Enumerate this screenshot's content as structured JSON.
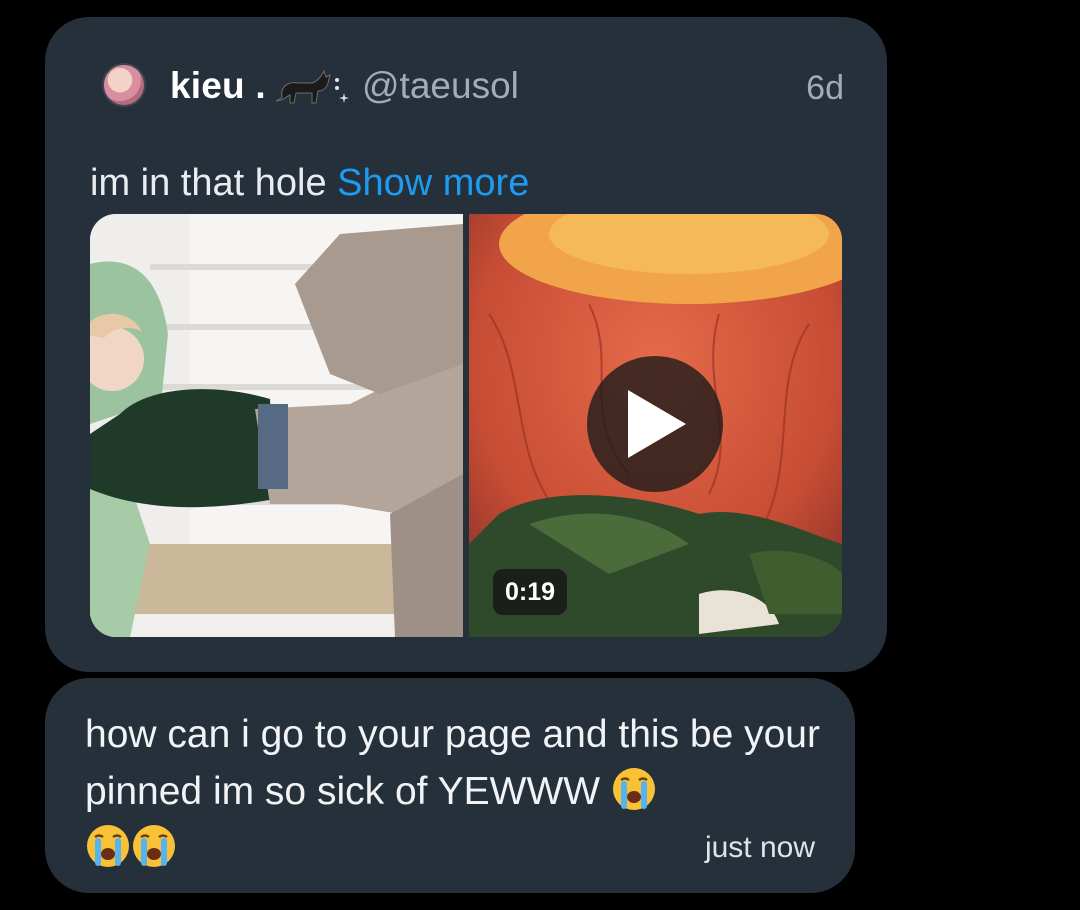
{
  "quoted_post": {
    "author_name": "kieu .",
    "author_handle": "@taeusol",
    "time": "6d",
    "text": "im in that hole ",
    "show_more_label": "Show more",
    "video_duration": "0:19",
    "icons": {
      "avatar": "avatar",
      "name_decoration": "cat-icon",
      "sparkle": "sparkle-icon",
      "play": "play-icon"
    }
  },
  "message": {
    "text": "how can i go to your page and this be your pinned im so sick of YEWWW",
    "emoji": "loudly-crying-face-icon",
    "emoji_count": 3,
    "time": "just now"
  },
  "colors": {
    "background": "#000000",
    "bubble": "#25303a",
    "link": "#1d9bf0",
    "muted_text": "#a1acb6"
  }
}
